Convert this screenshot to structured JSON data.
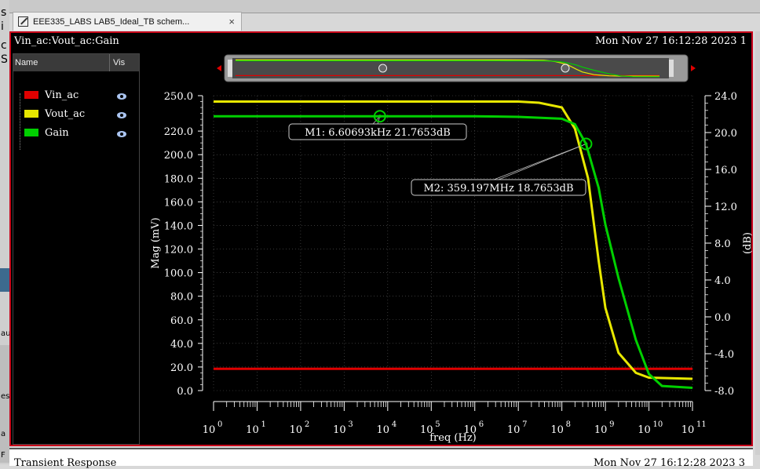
{
  "tab": {
    "label": "EEE335_LABS LAB5_Ideal_TB schem...",
    "close": "×"
  },
  "window": {
    "title_left": "Vin_ac:Vout_ac:Gain",
    "title_right": "Mon Nov 27 16:12:28 2023  1"
  },
  "legend": {
    "header_name": "Name",
    "header_vis": "Vis",
    "items": [
      {
        "label": "Vin_ac",
        "color": "#e00000"
      },
      {
        "label": "Vout_ac",
        "color": "#e8e800"
      },
      {
        "label": "Gain",
        "color": "#00d000"
      }
    ]
  },
  "bottom_window": {
    "title_left": "Transient Response",
    "title_right": "Mon Nov 27 16:12:28 2023  3"
  },
  "left_strip": [
    "s",
    "i",
    "c",
    "S",
    "au",
    "es",
    "a",
    "F"
  ],
  "chart_data": {
    "type": "line",
    "xlabel": "freq (Hz)",
    "ylabel_left": "Mag (mV)",
    "ylabel_right": "(dB)",
    "x_scale": "log",
    "xlim": [
      1,
      100000000000
    ],
    "ylim_left": [
      0,
      250
    ],
    "ylim_right": [
      -8,
      24
    ],
    "x_ticks": [
      "0",
      "1",
      "2",
      "3",
      "4",
      "5",
      "6",
      "7",
      "8",
      "9",
      "10",
      "11"
    ],
    "y_ticks_left": [
      "0.0",
      "20.0",
      "40.0",
      "60.0",
      "80.0",
      "100.0",
      "120.0",
      "140.0",
      "160.0",
      "180.0",
      "200.0",
      "220.0",
      "250.0"
    ],
    "y_ticks_right": [
      "-8.0",
      "-4.0",
      "0.0",
      "4.0",
      "8.0",
      "12.0",
      "16.0",
      "20.0",
      "24.0"
    ],
    "grid": true,
    "series": [
      {
        "name": "Vin_ac",
        "axis": "left",
        "color": "#e00000",
        "x": [
          1,
          1000,
          1000000,
          100000000000
        ],
        "y": [
          18.5,
          18.5,
          18.5,
          18.5
        ]
      },
      {
        "name": "Vout_ac",
        "axis": "left",
        "color": "#e8e800",
        "x": [
          1,
          10000,
          1000000,
          10000000,
          30000000,
          100000000,
          200000000,
          400000000,
          700000000,
          1000000000,
          2000000000,
          5000000000,
          10000000000,
          100000000000
        ],
        "y": [
          245,
          245,
          245,
          245,
          244,
          240,
          222,
          180,
          110,
          70,
          32,
          15,
          11,
          10
        ]
      },
      {
        "name": "Gain",
        "axis": "right",
        "color": "#00d000",
        "x": [
          1,
          10000,
          1000000,
          10000000,
          100000000,
          200000000,
          359197000,
          700000000,
          1000000000,
          2000000000,
          5000000000,
          10000000000,
          20000000000,
          100000000000
        ],
        "y": [
          21.77,
          21.77,
          21.77,
          21.7,
          21.5,
          20.9,
          18.77,
          14.0,
          10.0,
          4.2,
          -2.5,
          -6.2,
          -7.5,
          -7.7
        ]
      }
    ],
    "markers": [
      {
        "label": "M1: 6.60693kHz 21.7653dB",
        "x": 6606.93,
        "y": 21.7653,
        "axis": "right"
      },
      {
        "label": "M2: 359.197MHz 18.7653dB",
        "x": 359197000,
        "y": 18.7653,
        "axis": "right"
      }
    ]
  }
}
